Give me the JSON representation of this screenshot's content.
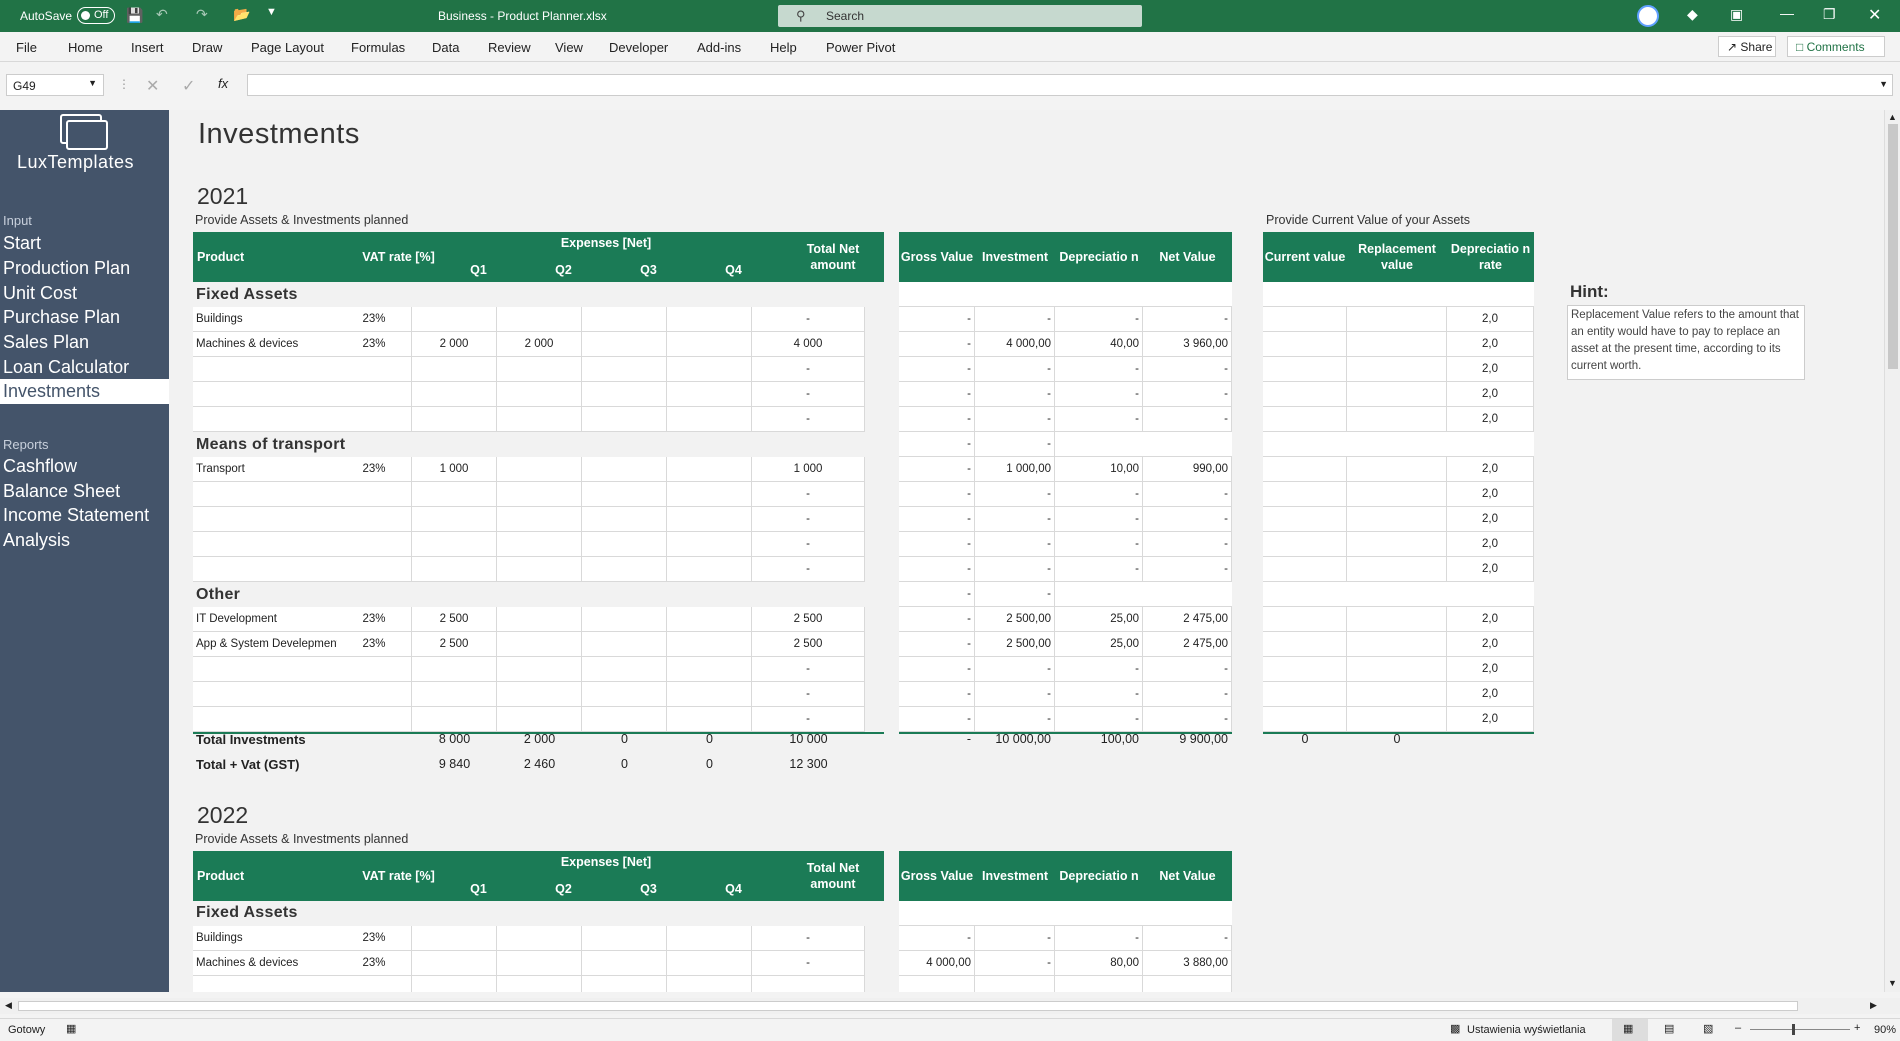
{
  "titlebar": {
    "autosave": "AutoSave",
    "toggle": "Off",
    "doc_title": "Business - Product Planner.xlsx",
    "search_placeholder": "Search"
  },
  "menu": [
    "File",
    "Home",
    "Insert",
    "Draw",
    "Page Layout",
    "Formulas",
    "Data",
    "Review",
    "View",
    "Developer",
    "Add-ins",
    "Help",
    "Power Pivot"
  ],
  "share": "Share",
  "comments": "Comments",
  "name_box": "G49",
  "fx": "fx",
  "logo_text": "LuxTemplates",
  "sidebar": {
    "input_label": "Input",
    "input_items": [
      "Start",
      "Production Plan",
      "Unit Cost",
      "Purchase Plan",
      "Sales Plan",
      "Loan Calculator",
      "Investments"
    ],
    "reports_label": "Reports",
    "report_items": [
      "Cashflow",
      "Balance Sheet",
      "Income Statement",
      "Analysis"
    ]
  },
  "page_title": "Investments",
  "hint": {
    "title": "Hint:",
    "text": "Replacement Value refers to the amount that an entity would have to pay to replace an asset at the present time, according to its current worth."
  },
  "headers": {
    "product": "Product",
    "vat": "VAT rate [%]",
    "expenses": "Expenses [Net]",
    "q": [
      "Q1",
      "Q2",
      "Q3",
      "Q4"
    ],
    "total_net": "Total Net amount",
    "gross": "Gross Value",
    "investment": "Investment",
    "depreciation": "Depreciatio n",
    "net_value": "Net Value",
    "current": "Current value",
    "replacement": "Replacement value",
    "dep_rate": "Depreciatio n rate"
  },
  "y2021": {
    "year": "2021",
    "subtitle": "Provide Assets & Investments planned",
    "right_subtitle": "Provide Current Value of your Assets",
    "sections": [
      {
        "name": "Fixed Assets",
        "rows": [
          {
            "p": "Buildings",
            "vat": "23%",
            "q": [
              "",
              "",
              "",
              ""
            ],
            "tot": "-",
            "g": "-",
            "i": "-",
            "d": "-",
            "n": "-",
            "r": "2,0"
          },
          {
            "p": "Machines & devices",
            "vat": "23%",
            "q": [
              "2 000",
              "2 000",
              "",
              ""
            ],
            "tot": "4 000",
            "g": "-",
            "i": "4 000,00",
            "d": "40,00",
            "n": "3 960,00",
            "r": "2,0"
          },
          {
            "p": "",
            "vat": "",
            "q": [
              "",
              "",
              "",
              ""
            ],
            "tot": "-",
            "g": "-",
            "i": "-",
            "d": "-",
            "n": "-",
            "r": "2,0"
          },
          {
            "p": "",
            "vat": "",
            "q": [
              "",
              "",
              "",
              ""
            ],
            "tot": "-",
            "g": "-",
            "i": "-",
            "d": "-",
            "n": "-",
            "r": "2,0"
          },
          {
            "p": "",
            "vat": "",
            "q": [
              "",
              "",
              "",
              ""
            ],
            "tot": "-",
            "g": "-",
            "i": "-",
            "d": "-",
            "n": "-",
            "r": "2,0"
          }
        ]
      },
      {
        "name": "Means of transport",
        "rows": [
          {
            "p": "Transport",
            "vat": "23%",
            "q": [
              "1 000",
              "",
              "",
              ""
            ],
            "tot": "1 000",
            "g": "-",
            "i": "1 000,00",
            "d": "10,00",
            "n": "990,00",
            "r": "2,0"
          },
          {
            "p": "",
            "vat": "",
            "q": [
              "",
              "",
              "",
              ""
            ],
            "tot": "-",
            "g": "-",
            "i": "-",
            "d": "-",
            "n": "-",
            "r": "2,0"
          },
          {
            "p": "",
            "vat": "",
            "q": [
              "",
              "",
              "",
              ""
            ],
            "tot": "-",
            "g": "-",
            "i": "-",
            "d": "-",
            "n": "-",
            "r": "2,0"
          },
          {
            "p": "",
            "vat": "",
            "q": [
              "",
              "",
              "",
              ""
            ],
            "tot": "-",
            "g": "-",
            "i": "-",
            "d": "-",
            "n": "-",
            "r": "2,0"
          },
          {
            "p": "",
            "vat": "",
            "q": [
              "",
              "",
              "",
              ""
            ],
            "tot": "-",
            "g": "-",
            "i": "-",
            "d": "-",
            "n": "-",
            "r": "2,0"
          }
        ]
      },
      {
        "name": "Other",
        "rows": [
          {
            "p": "IT Development",
            "vat": "23%",
            "q": [
              "2 500",
              "",
              "",
              ""
            ],
            "tot": "2 500",
            "g": "-",
            "i": "2 500,00",
            "d": "25,00",
            "n": "2 475,00",
            "r": "2,0"
          },
          {
            "p": "App & System Develepment",
            "vat": "23%",
            "q": [
              "2 500",
              "",
              "",
              ""
            ],
            "tot": "2 500",
            "g": "-",
            "i": "2 500,00",
            "d": "25,00",
            "n": "2 475,00",
            "r": "2,0"
          },
          {
            "p": "",
            "vat": "",
            "q": [
              "",
              "",
              "",
              ""
            ],
            "tot": "-",
            "g": "-",
            "i": "-",
            "d": "-",
            "n": "-",
            "r": "2,0"
          },
          {
            "p": "",
            "vat": "",
            "q": [
              "",
              "",
              "",
              ""
            ],
            "tot": "-",
            "g": "-",
            "i": "-",
            "d": "-",
            "n": "-",
            "r": "2,0"
          },
          {
            "p": "",
            "vat": "",
            "q": [
              "",
              "",
              "",
              ""
            ],
            "tot": "-",
            "g": "-",
            "i": "-",
            "d": "-",
            "n": "-",
            "r": "2,0"
          }
        ]
      }
    ],
    "section_dash": {
      "g": "-",
      "i": "-"
    },
    "total_label": "Total Investments",
    "total_q": [
      "8 000",
      "2 000",
      "0",
      "0"
    ],
    "total_tot": "10 000",
    "total_g": "-",
    "total_i": "10 000,00",
    "total_d": "100,00",
    "total_n": "9 900,00",
    "total_cur": "0",
    "total_rep": "0",
    "vat_label": "Total + Vat (GST)",
    "vat_q": [
      "9 840",
      "2 460",
      "0",
      "0"
    ],
    "vat_tot": "12 300"
  },
  "y2022": {
    "year": "2022",
    "subtitle": "Provide Assets & Investments planned",
    "section": "Fixed Assets",
    "rows": [
      {
        "p": "Buildings",
        "vat": "23%",
        "tot": "-",
        "g": "-",
        "i": "-",
        "d": "-",
        "n": "-"
      },
      {
        "p": "Machines & devices",
        "vat": "23%",
        "tot": "-",
        "g": "4 000,00",
        "i": "-",
        "d": "80,00",
        "n": "3 880,00"
      }
    ]
  },
  "status": {
    "ready": "Gotowy",
    "display": "Ustawienia wyświetlania",
    "zoom": "90%"
  }
}
